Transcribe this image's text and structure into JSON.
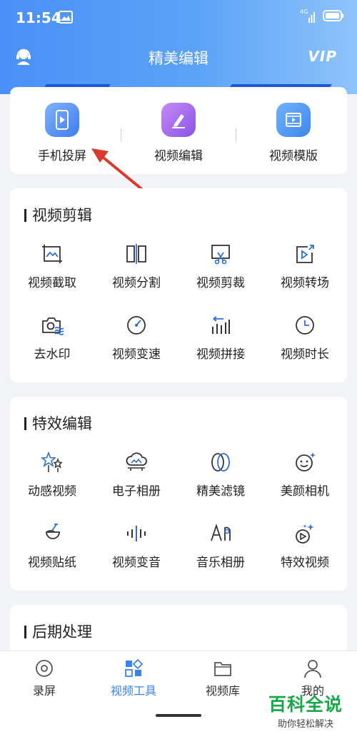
{
  "status_bar": {
    "time": "11:54",
    "network": "4G"
  },
  "nav": {
    "title": "精美编辑",
    "vip_label": "VIP"
  },
  "top_tools": [
    {
      "label": "手机投屏",
      "icon": "phone-cast-icon"
    },
    {
      "label": "视频编辑",
      "icon": "pencil-edit-icon"
    },
    {
      "label": "视频模版",
      "icon": "video-template-icon"
    }
  ],
  "sections": [
    {
      "title": "视频剪辑",
      "items": [
        {
          "label": "视频截取",
          "icon": "crop-image-icon"
        },
        {
          "label": "视频分割",
          "icon": "split-icon"
        },
        {
          "label": "视频剪裁",
          "icon": "scissors-screen-icon"
        },
        {
          "label": "视频转场",
          "icon": "transition-icon"
        },
        {
          "label": "去水印",
          "icon": "camera-watermark-icon"
        },
        {
          "label": "视频变速",
          "icon": "speedometer-icon"
        },
        {
          "label": "视频拼接",
          "icon": "bars-merge-icon"
        },
        {
          "label": "视频时长",
          "icon": "clock-icon"
        }
      ]
    },
    {
      "title": "特效编辑",
      "items": [
        {
          "label": "动感视频",
          "icon": "stars-icon"
        },
        {
          "label": "电子相册",
          "icon": "cloud-album-icon"
        },
        {
          "label": "精美滤镜",
          "icon": "filter-rings-icon"
        },
        {
          "label": "美颜相机",
          "icon": "face-sparkle-icon"
        },
        {
          "label": "视频贴纸",
          "icon": "sticker-icon"
        },
        {
          "label": "视频变音",
          "icon": "waveform-icon"
        },
        {
          "label": "音乐相册",
          "icon": "music-album-icon"
        },
        {
          "label": "特效视频",
          "icon": "effect-video-icon"
        }
      ]
    },
    {
      "title": "后期处理",
      "items": []
    }
  ],
  "bottom_tabs": [
    {
      "label": "录屏",
      "icon": "record-icon",
      "active": false
    },
    {
      "label": "视频工具",
      "icon": "tools-grid-icon",
      "active": true
    },
    {
      "label": "视频库",
      "icon": "folder-icon",
      "active": false
    },
    {
      "label": "我的",
      "icon": "person-icon",
      "active": false
    }
  ],
  "watermark": {
    "title": "百科全说",
    "subtitle": "助你轻松解决"
  },
  "colors": {
    "accent": "#3b82f6",
    "header": "#4a90f7",
    "icon_blue": "#2f6fd6",
    "watermark": "#18a84a",
    "arrow": "#d93a2b"
  }
}
